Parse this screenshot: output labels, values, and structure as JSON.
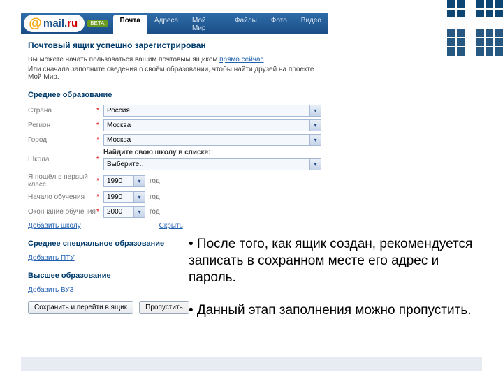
{
  "logo": {
    "at": "@",
    "name": "mail",
    "dot": ".",
    "ru": "ru",
    "beta": "BETA"
  },
  "tabs": [
    "Почта",
    "Адреса",
    "Мой Мир",
    "Файлы",
    "Фото",
    "Видео"
  ],
  "heading": "Почтовый ящик успешно зарегистрирован",
  "intro_line1_a": "Вы можете начать пользоваться вашим почтовым ящиком ",
  "intro_line1_link": "прямо сейчас",
  "intro_line2": "Или сначала заполните сведения о своём образовании, чтобы найти друзей на проекте Мой Мир.",
  "edu_section": "Среднее образование",
  "fields": {
    "country": {
      "label": "Страна",
      "value": "Россия"
    },
    "region": {
      "label": "Регион",
      "value": "Москва"
    },
    "city": {
      "label": "Город",
      "value": "Москва"
    },
    "school": {
      "label": "Школа",
      "helper": "Найдите свою школу в списке:",
      "value": "Выберите…"
    },
    "first_class": {
      "label": "Я пошёл в первый класс",
      "value": "1990",
      "unit": "год"
    },
    "start": {
      "label": "Начало обучения",
      "value": "1990",
      "unit": "год"
    },
    "end": {
      "label": "Окончание обучения",
      "value": "2000",
      "unit": "год"
    }
  },
  "add_school": "Добавить школу",
  "hide": "Скрыть",
  "spo_section": "Среднее специальное образование",
  "add_ptu": "Добавить ПТУ",
  "higher_section": "Высшее образование",
  "add_vuz": "Добавить ВУЗ",
  "btn_save": "Сохранить и перейти в ящик",
  "btn_skip": "Пропустить",
  "annotations": {
    "a1": "• После того, как ящик создан, рекомендуется записать в сохранном месте  его адрес и пароль.",
    "a2": "• Данный этап заполнения можно пропустить."
  }
}
